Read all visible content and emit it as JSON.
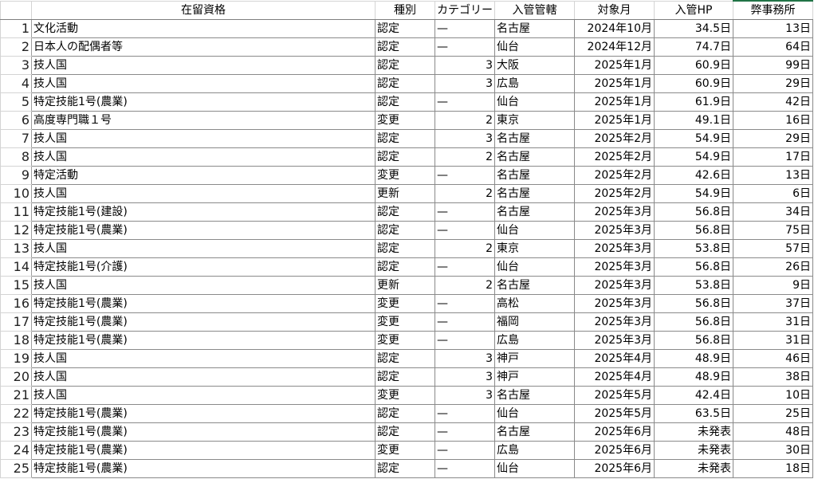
{
  "columns": [
    {
      "key": "status",
      "label": "在留資格"
    },
    {
      "key": "kind",
      "label": "種別"
    },
    {
      "key": "category",
      "label": "カテゴリー"
    },
    {
      "key": "office",
      "label": "入管管轄"
    },
    {
      "key": "month",
      "label": "対象月"
    },
    {
      "key": "hp",
      "label": "入管HP"
    },
    {
      "key": "firm",
      "label": "弊事務所"
    }
  ],
  "rows": [
    {
      "n": "1",
      "status": "文化活動",
      "kind": "認定",
      "category": "—",
      "office": "名古屋",
      "month": "2024年10月",
      "hp": "34.5日",
      "firm": "13日"
    },
    {
      "n": "2",
      "status": "日本人の配偶者等",
      "kind": "認定",
      "category": "—",
      "office": "仙台",
      "month": "2024年12月",
      "hp": "74.7日",
      "firm": "64日"
    },
    {
      "n": "3",
      "status": "技人国",
      "kind": "認定",
      "category": "3",
      "office": "大阪",
      "month": "2025年1月",
      "hp": "60.9日",
      "firm": "99日"
    },
    {
      "n": "4",
      "status": "技人国",
      "kind": "認定",
      "category": "3",
      "office": "広島",
      "month": "2025年1月",
      "hp": "60.9日",
      "firm": "29日"
    },
    {
      "n": "5",
      "status": "特定技能1号(農業)",
      "kind": "認定",
      "category": "—",
      "office": "仙台",
      "month": "2025年1月",
      "hp": "61.9日",
      "firm": "42日"
    },
    {
      "n": "6",
      "status": "高度専門職１号",
      "kind": "変更",
      "category": "2",
      "office": "東京",
      "month": "2025年1月",
      "hp": "49.1日",
      "firm": "16日"
    },
    {
      "n": "7",
      "status": "技人国",
      "kind": "認定",
      "category": "3",
      "office": "名古屋",
      "month": "2025年2月",
      "hp": "54.9日",
      "firm": "29日"
    },
    {
      "n": "8",
      "status": "技人国",
      "kind": "認定",
      "category": "2",
      "office": "名古屋",
      "month": "2025年2月",
      "hp": "54.9日",
      "firm": "17日"
    },
    {
      "n": "9",
      "status": "特定活動",
      "kind": "変更",
      "category": "—",
      "office": "名古屋",
      "month": "2025年2月",
      "hp": "42.6日",
      "firm": "13日"
    },
    {
      "n": "10",
      "status": "技人国",
      "kind": "更新",
      "category": "2",
      "office": "名古屋",
      "month": "2025年2月",
      "hp": "54.9日",
      "firm": "6日"
    },
    {
      "n": "11",
      "status": "特定技能1号(建設)",
      "kind": "認定",
      "category": "—",
      "office": "名古屋",
      "month": "2025年3月",
      "hp": "56.8日",
      "firm": "34日"
    },
    {
      "n": "12",
      "status": "特定技能1号(農業)",
      "kind": "認定",
      "category": "—",
      "office": "仙台",
      "month": "2025年3月",
      "hp": "56.8日",
      "firm": "75日"
    },
    {
      "n": "13",
      "status": "技人国",
      "kind": "認定",
      "category": "2",
      "office": "東京",
      "month": "2025年3月",
      "hp": "53.8日",
      "firm": "57日"
    },
    {
      "n": "14",
      "status": "特定技能1号(介護)",
      "kind": "認定",
      "category": "—",
      "office": "仙台",
      "month": "2025年3月",
      "hp": "56.8日",
      "firm": "26日"
    },
    {
      "n": "15",
      "status": "技人国",
      "kind": "更新",
      "category": "2",
      "office": "名古屋",
      "month": "2025年3月",
      "hp": "53.8日",
      "firm": "9日"
    },
    {
      "n": "16",
      "status": "特定技能1号(農業)",
      "kind": "変更",
      "category": "—",
      "office": "高松",
      "month": "2025年3月",
      "hp": "56.8日",
      "firm": "37日"
    },
    {
      "n": "17",
      "status": "特定技能1号(農業)",
      "kind": "変更",
      "category": "—",
      "office": "福岡",
      "month": "2025年3月",
      "hp": "56.8日",
      "firm": "31日"
    },
    {
      "n": "18",
      "status": "特定技能1号(農業)",
      "kind": "変更",
      "category": "—",
      "office": "広島",
      "month": "2025年3月",
      "hp": "56.8日",
      "firm": "31日"
    },
    {
      "n": "19",
      "status": "技人国",
      "kind": "認定",
      "category": "3",
      "office": "神戸",
      "month": "2025年4月",
      "hp": "48.9日",
      "firm": "46日"
    },
    {
      "n": "20",
      "status": "技人国",
      "kind": "認定",
      "category": "3",
      "office": "神戸",
      "month": "2025年4月",
      "hp": "48.9日",
      "firm": "38日"
    },
    {
      "n": "21",
      "status": "技人国",
      "kind": "変更",
      "category": "3",
      "office": "名古屋",
      "month": "2025年5月",
      "hp": "42.4日",
      "firm": "10日"
    },
    {
      "n": "22",
      "status": "特定技能1号(農業)",
      "kind": "認定",
      "category": "—",
      "office": "仙台",
      "month": "2025年5月",
      "hp": "63.5日",
      "firm": "25日"
    },
    {
      "n": "23",
      "status": "特定技能1号(農業)",
      "kind": "認定",
      "category": "—",
      "office": "名古屋",
      "month": "2025年6月",
      "hp": "未発表",
      "firm": "48日"
    },
    {
      "n": "24",
      "status": "特定技能1号(農業)",
      "kind": "変更",
      "category": "—",
      "office": "広島",
      "month": "2025年6月",
      "hp": "未発表",
      "firm": "30日"
    },
    {
      "n": "25",
      "status": "特定技能1号(農業)",
      "kind": "認定",
      "category": "—",
      "office": "仙台",
      "month": "2025年6月",
      "hp": "未発表",
      "firm": "18日"
    }
  ],
  "colors": {
    "selected_column_accent": "#217346",
    "grid_line": "#8a8a8a"
  }
}
